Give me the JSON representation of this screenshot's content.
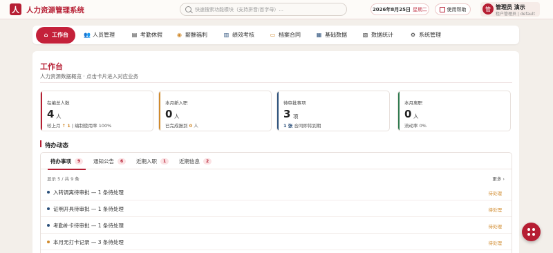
{
  "app": {
    "logo_char": "人",
    "title": "人力资源管理系统"
  },
  "header": {
    "search_placeholder": "快速搜索功能模块（支持拼音/首字母）...",
    "date": "2026年8月25日",
    "weekday": "星期二",
    "help_label": "使用帮助",
    "user_avatar_char": "管",
    "user_name": "管理员 演示",
    "user_sub": "租户管理员 | default"
  },
  "nav": {
    "items": [
      {
        "label": "工作台",
        "icon": "home-icon",
        "glyph": "⌂"
      },
      {
        "label": "人员管理",
        "icon": "people-icon",
        "glyph": "👥"
      },
      {
        "label": "考勤休假",
        "icon": "calendar-icon",
        "glyph": "▤"
      },
      {
        "label": "薪酬福利",
        "icon": "coin-icon",
        "glyph": "◉"
      },
      {
        "label": "绩效考核",
        "icon": "chart-icon",
        "glyph": "▥"
      },
      {
        "label": "档案合同",
        "icon": "folder-icon",
        "glyph": "▭"
      },
      {
        "label": "基础数据",
        "icon": "grid-icon",
        "glyph": "▦"
      },
      {
        "label": "数据统计",
        "icon": "stats-icon",
        "glyph": "▧"
      },
      {
        "label": "系统管理",
        "icon": "gear-icon",
        "glyph": "⚙"
      }
    ]
  },
  "page": {
    "title": "工作台",
    "subtitle": "人力资源数据概览 · 点击卡片进入对应业务"
  },
  "stats": [
    {
      "label": "在编总人数",
      "value": "4",
      "unit": "人",
      "foot_pre": "较上月",
      "foot_hl": "↑ 1",
      "foot_post": "| 编制使用率 100%",
      "color": "#b61e33",
      "hl_color": "#d08a2c"
    },
    {
      "label": "本月新入职",
      "value": "0",
      "unit": "人",
      "foot_pre": "已完成报到",
      "foot_hl": "0",
      "foot_post": "人",
      "color": "#d08a2c",
      "hl_color": "#d08a2c"
    },
    {
      "label": "待审批事项",
      "value": "3",
      "unit": "项",
      "foot_pre": "",
      "foot_hl": "1 张",
      "foot_post": "合同即将到期",
      "color": "#2a4f7a",
      "hl_color": "#2a4f7a"
    },
    {
      "label": "本月离职",
      "value": "0",
      "unit": "人",
      "foot_pre": "流动率 0%",
      "foot_hl": "",
      "foot_post": "",
      "color": "#2f7a4f",
      "hl_color": "#2f7a4f"
    }
  ],
  "todo": {
    "section_title": "待办动态",
    "tabs": [
      {
        "label": "待办事项",
        "count": "9"
      },
      {
        "label": "通知公告",
        "count": "6"
      },
      {
        "label": "近期入职",
        "count": "1"
      },
      {
        "label": "近期信息",
        "count": "2"
      }
    ],
    "show_count": "显示 5 / 共 9 条",
    "more_label": "更多 ›",
    "rows": [
      {
        "text": "入转调离待审批 — 1 条待处理",
        "status": "待处理",
        "dot": "#2a4f7a"
      },
      {
        "text": "证明开具待审批 — 1 条待处理",
        "status": "待处理",
        "dot": "#2a4f7a"
      },
      {
        "text": "考勤补卡待审批 — 1 条待处理",
        "status": "待处理",
        "dot": "#2a4f7a"
      },
      {
        "text": "本月无打卡记录 — 3 条待处理",
        "status": "待处理",
        "dot": "#d08a2c"
      }
    ]
  },
  "colors": {
    "brand": "#b61e33",
    "accent": "#d08a2c"
  }
}
